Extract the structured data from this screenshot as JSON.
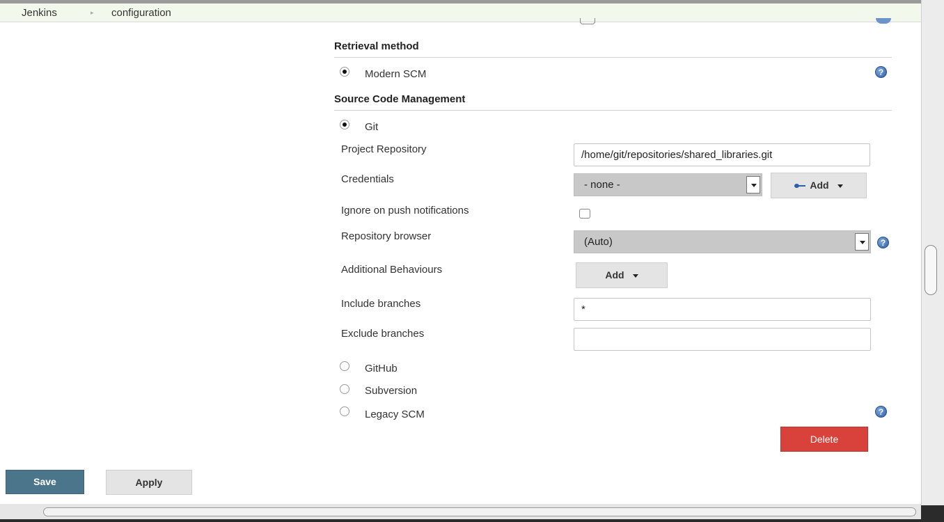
{
  "breadcrumb": {
    "items": [
      "Jenkins",
      "configuration"
    ],
    "separator": "▸"
  },
  "retrieval": {
    "heading": "Retrieval method",
    "option_label": "Modern SCM",
    "help_icon": "question-circle-icon"
  },
  "scm": {
    "heading": "Source Code Management",
    "git_label": "Git",
    "project_repository": {
      "label": "Project Repository",
      "value": "/home/git/repositories/shared_libraries.git"
    },
    "credentials": {
      "label": "Credentials",
      "selected": "- none -",
      "add_label": "Add",
      "add_icon": "key-icon"
    },
    "ignore_push": {
      "label": "Ignore on push notifications",
      "checked": false
    },
    "repo_browser": {
      "label": "Repository browser",
      "selected": "(Auto)"
    },
    "additional_behaviours": {
      "label": "Additional Behaviours",
      "add_label": "Add"
    },
    "include_branches": {
      "label": "Include branches",
      "value": "*"
    },
    "exclude_branches": {
      "label": "Exclude branches",
      "value": ""
    },
    "other_options": [
      "GitHub",
      "Subversion",
      "Legacy SCM"
    ],
    "delete_label": "Delete"
  },
  "footer": {
    "save_label": "Save",
    "apply_label": "Apply"
  },
  "colors": {
    "save": "#4b758b",
    "delete": "#d9413b",
    "breadcrumb_bg": "#f3f8ec",
    "select_bg": "#c8c8c8"
  }
}
